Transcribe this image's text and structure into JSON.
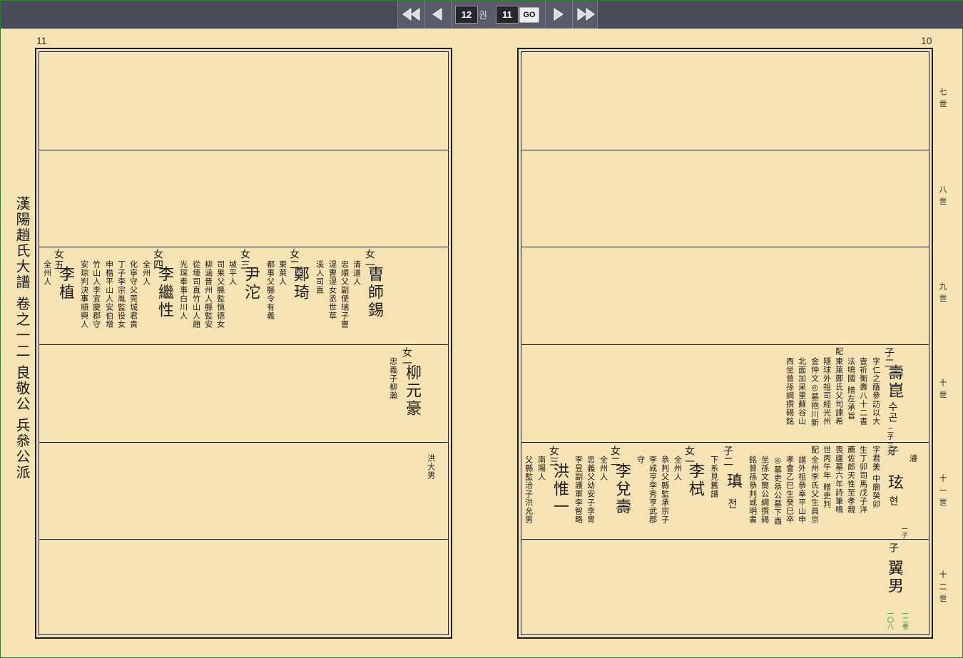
{
  "nav": {
    "volume": "12",
    "volume_unit": "권",
    "page": "11",
    "go_label": "GO"
  },
  "left_page": {
    "page_number": "11",
    "side_title": "漢陽趙氏大譜 卷之一二 良敬公 兵叅公派",
    "row3": {
      "d1_rank": "女一",
      "d1_name": "曺師錫",
      "d1_c1": "清道人",
      "d1_c2": "忠順父副使瑞子曺",
      "d1_c3": "湜曺湜女丞世草",
      "d1_c4": "溪人司直",
      "d2_rank": "女二",
      "d2_name": "鄭琦",
      "d2_c1": "東萊人",
      "d2_c2": "都事父縣令有義",
      "d3_rank": "女三",
      "d3_name": "尹沱",
      "d3_c1": "坡平人",
      "d3_c2": "司果父縣監慎德女",
      "d3_c3": "柳涵晋州人縣監安",
      "d3_c4": "從壕司直竹山人趙",
      "d3_c5": "光琛奉事白川人",
      "d4_rank": "女四",
      "d4_name": "李繼性",
      "d4_c1": "全州人",
      "d4_c2": "化寧守父莞城君貴",
      "d4_c3": "丁子李宗胤監役女",
      "d4_c4": "申楷平山人安伯增",
      "d4_c5": "竹山人李宜慶郡守",
      "d4_c6": "安琮判決事順興人",
      "d5_rank": "女五",
      "d5_name": "李植",
      "d5_c1": "全州人"
    },
    "row4": {
      "rank": "女一",
      "name": "柳元豪",
      "c1": "忠義子柳瀚"
    },
    "row5": {
      "c1": "洪大男"
    }
  },
  "right_page": {
    "page_number": "10",
    "generations": [
      "七世",
      "八世",
      "九世",
      "十世",
      "十一世",
      "十二世"
    ],
    "row4": {
      "rank": "子二",
      "name": "壽崑",
      "hangul": "수곤",
      "note": "二子 三女",
      "c1": "字仁之蔭參訪以大",
      "c2": "壹祈衡壽八十二書",
      "c3": "法鳴國 贈左承旨",
      "c4": "配",
      "c5": "東萊鄭氏父司諫希",
      "c6": "隱球外祖司經光州",
      "c7": "金仲文◎墓抱川新",
      "c8": "北面加采里蘇谷山",
      "c9": "西坐曾孫綱撰碣銘"
    },
    "row5": {
      "s_rank": "子",
      "s_name_note": "濬",
      "s_name": "玹",
      "s_hangul": "현",
      "s_note": "一子",
      "s_c1": "字君美 中廟癸卯",
      "s_c2": "生丁卯司馬戊子洋",
      "s_c3": "薦佐郎天性至孝親",
      "s_c4": "喪廬墓六年詩筆鳴",
      "s_c5": "世丙午年 贈吏判",
      "s_c6": "配",
      "s_c7": "全州李氏父生員京",
      "s_c8": "諧外祖叅奉平山申",
      "s_c9": "孝會乙巳生癸巳卒",
      "s_c10": "◎墓吏叅公墓下酉",
      "s_c11": "坐孫文簡公綱撰碣",
      "s_c12": "銘曾孫叅判咸明書",
      "b_rank": "子二",
      "b_name": "瑱",
      "b_hangul": "전",
      "b_c1": "下系見舊譜",
      "g1_rank": "女一",
      "g1_name": "李栻",
      "g1_c1": "全州人",
      "g1_c2": "叅判父縣監承宗子",
      "g1_c3": "李咸亨李秀亨武郡",
      "g1_c4": "守",
      "g2_rank": "女二",
      "g2_name": "李兌壽",
      "g2_c1": "全州人",
      "g2_c2": "忠義父幼安子李冑",
      "g2_c3": "李昱副護軍李智略",
      "g3_rank": "女三",
      "g3_name": "洪惟一",
      "g3_c1": "南陽人",
      "g3_c2": "父縣監洽子洪允男"
    },
    "row6": {
      "rank": "子",
      "name": "翼男",
      "ref1": "一二卷",
      "ref2": "一〇八"
    }
  }
}
